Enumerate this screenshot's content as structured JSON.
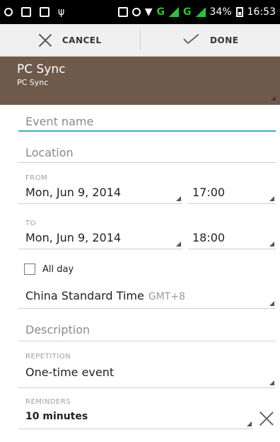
{
  "statusbar": {
    "network1": "G",
    "network2": "G",
    "battery_percent": "34%",
    "time": "16:53"
  },
  "actionbar": {
    "cancel_label": "CANCEL",
    "done_label": "DONE"
  },
  "calendar": {
    "title": "PC Sync",
    "subtitle": "PC Sync",
    "header_color": "#6e5a4a"
  },
  "form": {
    "event_name_placeholder": "Event name",
    "location_placeholder": "Location",
    "from_label": "FROM",
    "from_date": "Mon, Jun 9, 2014",
    "from_time": "17:00",
    "to_label": "TO",
    "to_date": "Mon, Jun 9, 2014",
    "to_time": "18:00",
    "allday_label": "All day",
    "allday_checked": false,
    "timezone_name": "China Standard Time",
    "timezone_offset": "GMT+8",
    "description_placeholder": "Description",
    "repetition_label": "REPETITION",
    "repetition_value": "One-time event",
    "reminders_label": "REMINDERS",
    "reminder_value": "10 minutes"
  },
  "colors": {
    "accent": "#4aa6c9",
    "network_green": "#2fbf3a"
  }
}
